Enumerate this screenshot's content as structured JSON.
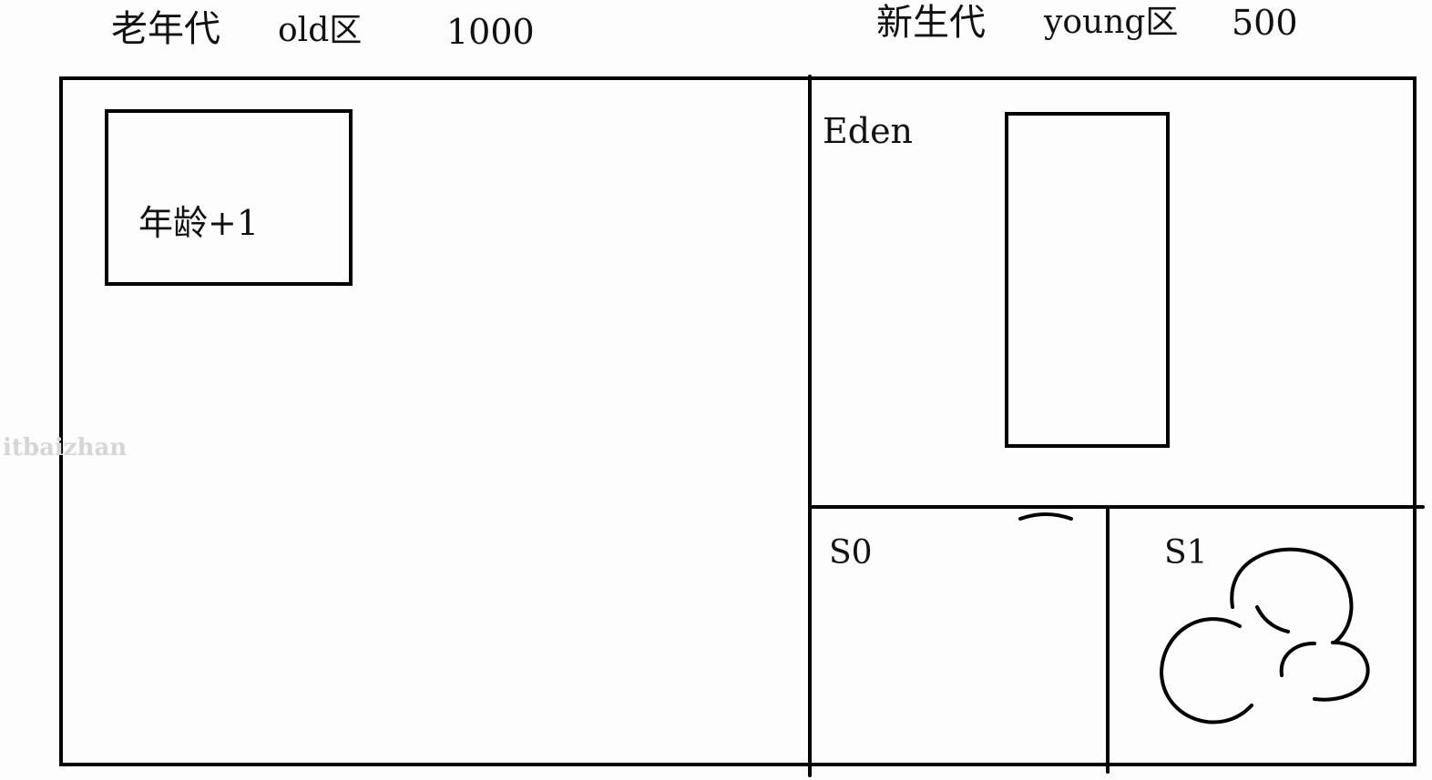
{
  "old_gen": {
    "label_cn": "老年代",
    "label_area": "old区",
    "size": "1000",
    "box_label": "年龄+1"
  },
  "young_gen": {
    "label_cn": "新生代",
    "label_area": "young区",
    "size": "500"
  },
  "eden": {
    "label": "Eden"
  },
  "s0": {
    "label": "S0"
  },
  "s1": {
    "label": "S1"
  },
  "watermark": "itbaizhan",
  "colors": {
    "stroke": "#000000",
    "background": "#fdfdfd",
    "watermark": "#d6d6d6"
  }
}
